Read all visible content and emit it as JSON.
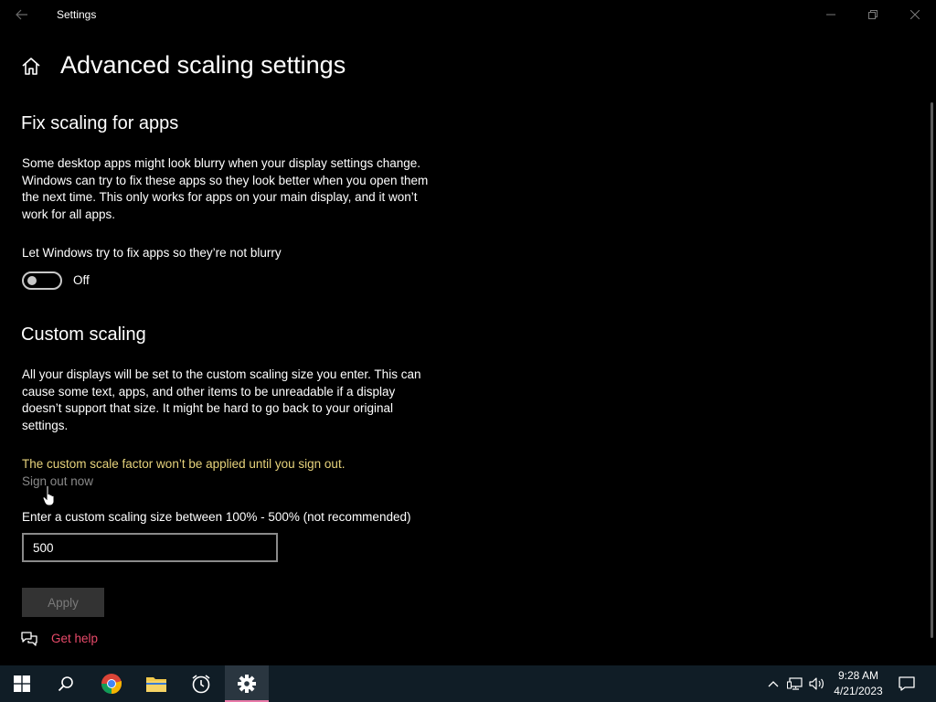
{
  "window": {
    "title": "Settings"
  },
  "page": {
    "title": "Advanced scaling settings"
  },
  "fix_scaling": {
    "heading": "Fix scaling for apps",
    "description": "Some desktop apps might look blurry when your display settings change. Windows can try to fix these apps so they look better when you open them the next time. This only works for apps on your main display, and it won’t work for all apps.",
    "toggle_label": "Let Windows try to fix apps so they’re not blurry",
    "toggle_state": "Off",
    "toggle_on": false
  },
  "custom_scaling": {
    "heading": "Custom scaling",
    "description": "All your displays will be set to the custom scaling size you enter. This can cause some text, apps, and other items to be unreadable if a display doesn’t support that size. It might be hard to go back to your original settings.",
    "warning": "The custom scale factor won’t be applied until you sign out.",
    "sign_out_link": "Sign out now",
    "input_label": "Enter a custom scaling size between 100% - 500% (not recommended)",
    "input_value": "500",
    "apply_label": "Apply"
  },
  "help": {
    "label": "Get help"
  },
  "colors": {
    "background": "#000000",
    "warning": "#e7d37c",
    "link": "#e84a6a",
    "taskbar": "#101d26",
    "accent": "#e879a8"
  },
  "taskbar": {
    "items": [
      {
        "icon": "windows-start-icon"
      },
      {
        "icon": "search-icon"
      },
      {
        "icon": "chrome-icon"
      },
      {
        "icon": "file-explorer-icon"
      },
      {
        "icon": "alarms-clock-icon"
      },
      {
        "icon": "settings-gear-icon",
        "active": true
      }
    ],
    "tray": [
      "chevron-up-icon",
      "network-icon",
      "volume-icon"
    ],
    "time": "9:28 AM",
    "date": "4/21/2023",
    "notification_icon": "action-center-icon"
  }
}
